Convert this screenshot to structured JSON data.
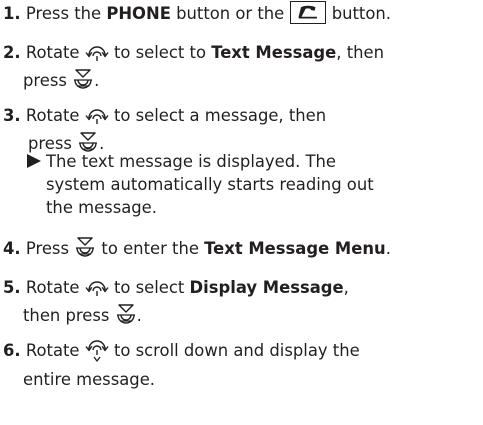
{
  "steps": [
    {
      "num": "1.",
      "t1": "Press the ",
      "em1": "PHONE",
      "t2": " button or the ",
      "t3": " button."
    },
    {
      "num": "2.",
      "t1": "Rotate ",
      "t2": " to select to ",
      "em1": "Text Message",
      "t3": ", then",
      "t4": "press ",
      "t5": "."
    },
    {
      "num": "3.",
      "t1": "Rotate ",
      "t2": " to select a message, then",
      "t3": "press ",
      "t4": ".",
      "result": [
        "The text message is displayed. The",
        "system automatically starts reading out",
        "the message."
      ]
    },
    {
      "num": "4.",
      "t1": "Press ",
      "t2": " to enter the ",
      "em1": "Text Message Menu",
      "t3": "."
    },
    {
      "num": "5.",
      "t1": "Rotate ",
      "t2": " to select ",
      "em1": "Display Message",
      "t3": ",",
      "t4": "then press ",
      "t5": "."
    },
    {
      "num": "6.",
      "t1": "Rotate ",
      "t2": " to scroll down and display the",
      "t3": "entire message."
    }
  ],
  "icons": {
    "phone_button": "phone-handset-icon",
    "rotate": "interface-dial-rotate-icon",
    "rotate_down": "interface-dial-rotate-down-icon",
    "press": "interface-dial-press-icon",
    "result": "result-arrow-icon"
  }
}
